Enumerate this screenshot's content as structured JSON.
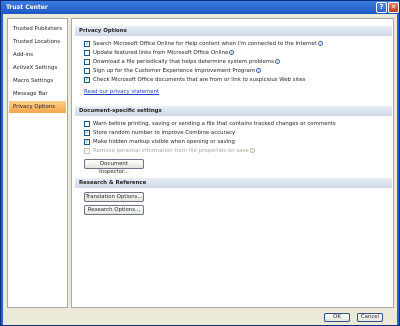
{
  "window": {
    "title": "Trust Center",
    "help_label": "?",
    "close_label": "✕"
  },
  "sidebar": {
    "items": [
      {
        "label": "Trusted Publishers"
      },
      {
        "label": "Trusted Locations"
      },
      {
        "label": "Add-ins"
      },
      {
        "label": "ActiveX Settings"
      },
      {
        "label": "Macro Settings"
      },
      {
        "label": "Message Bar"
      },
      {
        "label": "Privacy Options",
        "selected": true
      }
    ]
  },
  "privacy": {
    "header": "Privacy Options",
    "options": [
      {
        "label": "Search Microsoft Office Online for Help content when I'm connected to the Internet",
        "checked": true,
        "info": true
      },
      {
        "label": "Update featured links from Microsoft Office Online",
        "checked": false,
        "info": true
      },
      {
        "label": "Download a file periodically that helps determine system problems",
        "checked": false,
        "info": true
      },
      {
        "label": "Sign up for the Customer Experience Improvement Program",
        "checked": false,
        "info": true
      },
      {
        "label": "Check Microsoft Office documents that are from or link to suspicious Web sites",
        "checked": true,
        "info": false
      }
    ],
    "statement_link": "Read our privacy statement"
  },
  "document": {
    "header": "Document-specific settings",
    "options": [
      {
        "label": "Warn before printing, saving or sending a file that contains tracked changes or comments",
        "checked": false,
        "disabled": false,
        "info": false
      },
      {
        "label": "Store random number to improve Combine accuracy",
        "checked": true,
        "disabled": false,
        "info": false
      },
      {
        "label": "Make hidden markup visible when opening or saving",
        "checked": true,
        "disabled": false,
        "info": false
      },
      {
        "label": "Remove personal information from file properties on save",
        "checked": false,
        "disabled": true,
        "info": true
      }
    ],
    "inspector_button": "Document Inspector..."
  },
  "research": {
    "header": "Research & Reference",
    "translation_button": "Translation Options...",
    "research_button": "Research Options..."
  },
  "footer": {
    "ok_label": "OK",
    "cancel_label": "Cancel"
  },
  "colors": {
    "title_bar": "#2a63c8",
    "selected_item": "#f6a44a",
    "check_mark": "#21a121",
    "link": "#1a3fbf"
  }
}
